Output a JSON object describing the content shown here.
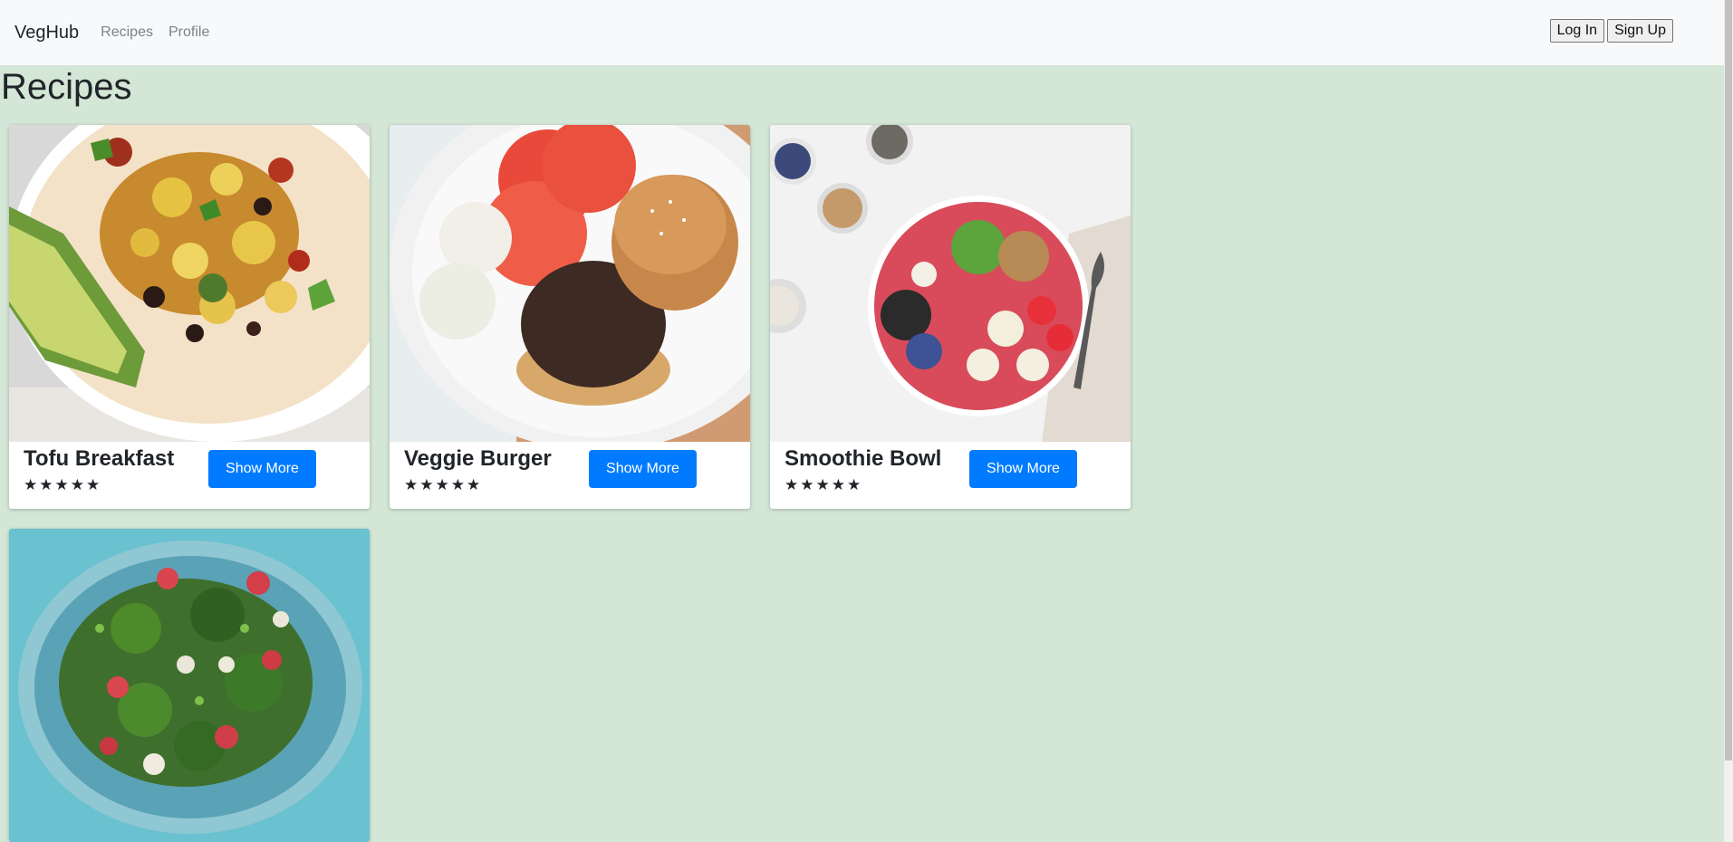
{
  "navbar": {
    "brand": "VegHub",
    "links": [
      "Recipes",
      "Profile"
    ],
    "login": "Log In",
    "signup": "Sign Up"
  },
  "page": {
    "title": "Recipes"
  },
  "cards": [
    {
      "title": "Tofu Breakfast",
      "stars": "★★★★★",
      "rating": 5,
      "button": "Show More"
    },
    {
      "title": "Veggie Burger",
      "stars": "★★★★★",
      "rating": 5,
      "button": "Show More"
    },
    {
      "title": "Smoothie Bowl",
      "stars": "★★★★★",
      "rating": 5,
      "button": "Show More"
    },
    {
      "title": "",
      "stars": "",
      "button": ""
    }
  ],
  "colors": {
    "background": "#d4e7d7",
    "navbar": "#f8f9fa",
    "primary": "#007bff"
  }
}
